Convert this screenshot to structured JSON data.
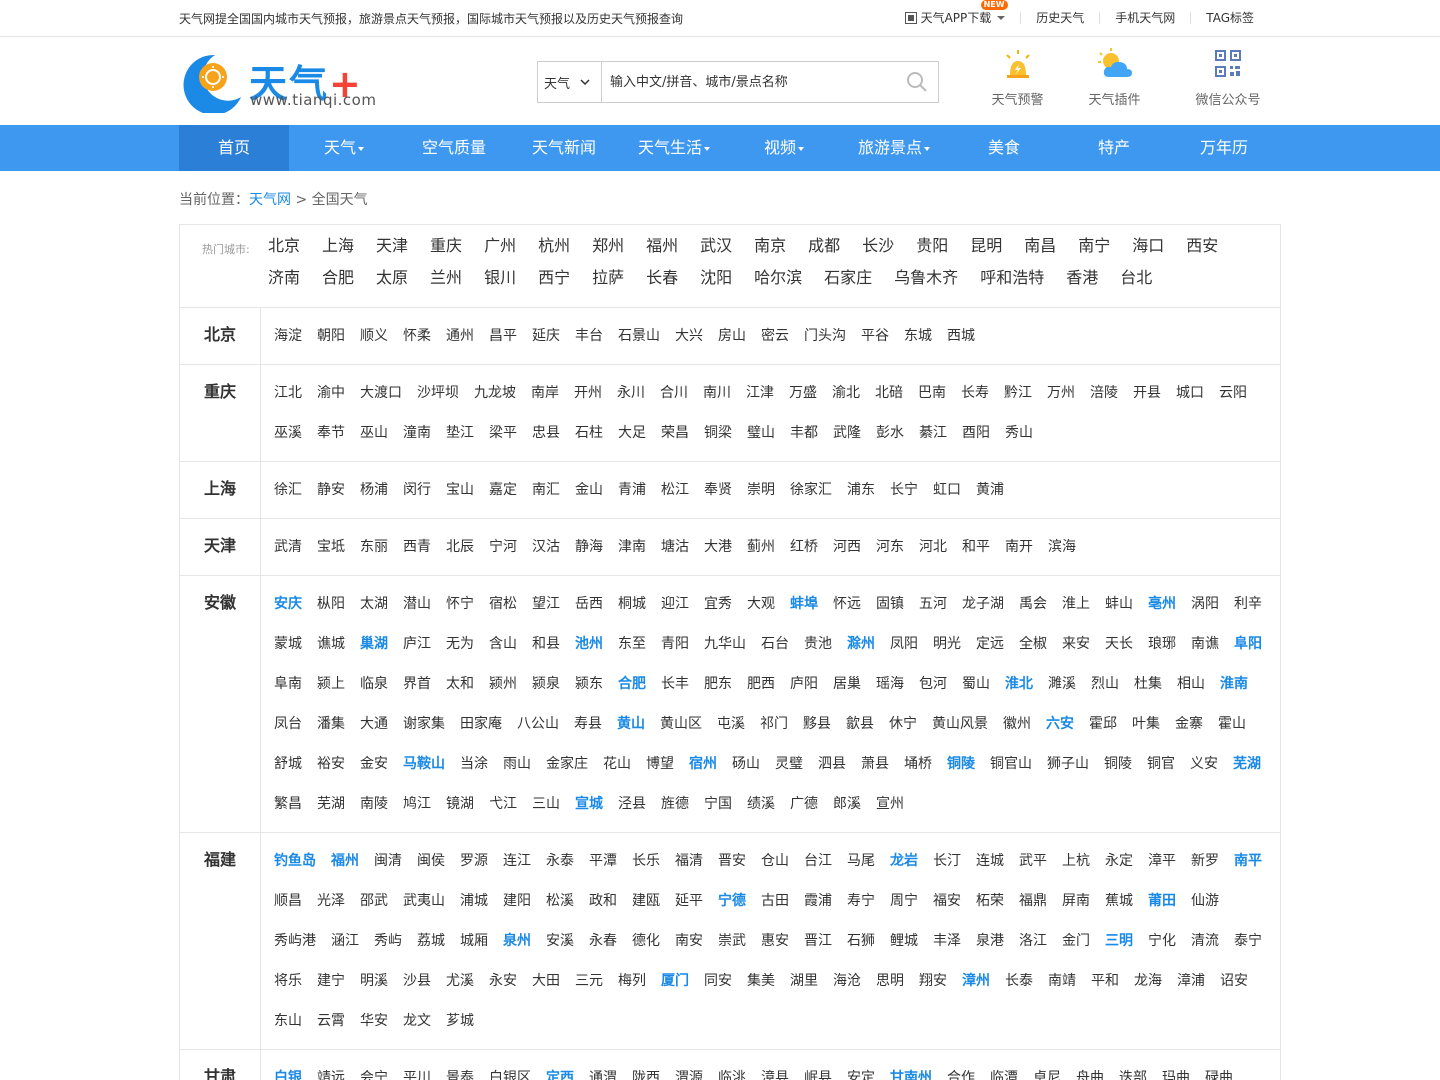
{
  "top": {
    "intro": "天气网提全国国内城市天气预报，旅游景点天气预报，国际城市天气预报以及历史天气预报查询",
    "app_download": "天气APP下载",
    "new_badge": "NEW",
    "history": "历史天气",
    "mobile": "手机天气网",
    "tags": "TAG标签"
  },
  "header": {
    "logo_text": "天气",
    "logo_plus": "+",
    "logo_url": "www.tianqi.com",
    "search_select": "天气",
    "search_placeholder": "输入中文/拼音、城市/景点名称",
    "tools": [
      {
        "label": "天气预警",
        "icon": "warning-sun-icon"
      },
      {
        "label": "天气插件",
        "icon": "cloud-sun-icon"
      },
      {
        "label": "微信公众号",
        "icon": "qrcode-icon"
      }
    ]
  },
  "nav": {
    "items": [
      {
        "label": "首页",
        "dropdown": false,
        "active": true
      },
      {
        "label": "天气",
        "dropdown": true
      },
      {
        "label": "空气质量",
        "dropdown": false
      },
      {
        "label": "天气新闻",
        "dropdown": false
      },
      {
        "label": "天气生活",
        "dropdown": true
      },
      {
        "label": "视频",
        "dropdown": true
      },
      {
        "label": "旅游景点",
        "dropdown": true
      },
      {
        "label": "美食",
        "dropdown": false
      },
      {
        "label": "特产",
        "dropdown": false
      },
      {
        "label": "万年历",
        "dropdown": false
      }
    ]
  },
  "breadcrumb": {
    "prefix": "当前位置：",
    "home": "天气网",
    "sep": " > ",
    "current": "全国天气"
  },
  "hot": {
    "label": "热门城市:",
    "cities": [
      "北京",
      "上海",
      "天津",
      "重庆",
      "广州",
      "杭州",
      "郑州",
      "福州",
      "武汉",
      "南京",
      "成都",
      "长沙",
      "贵阳",
      "昆明",
      "南昌",
      "南宁",
      "海口",
      "西安",
      "济南",
      "合肥",
      "太原",
      "兰州",
      "银川",
      "西宁",
      "拉萨",
      "长春",
      "沈阳",
      "哈尔滨",
      "石家庄",
      "乌鲁木齐",
      "呼和浩特",
      "香港",
      "台北"
    ]
  },
  "provinces": [
    {
      "name": "北京",
      "cities": [
        [
          "海淀",
          0
        ],
        [
          "朝阳",
          0
        ],
        [
          "顺义",
          0
        ],
        [
          "怀柔",
          0
        ],
        [
          "通州",
          0
        ],
        [
          "昌平",
          0
        ],
        [
          "延庆",
          0
        ],
        [
          "丰台",
          0
        ],
        [
          "石景山",
          0
        ],
        [
          "大兴",
          0
        ],
        [
          "房山",
          0
        ],
        [
          "密云",
          0
        ],
        [
          "门头沟",
          0
        ],
        [
          "平谷",
          0
        ],
        [
          "东城",
          0
        ],
        [
          "西城",
          0
        ]
      ]
    },
    {
      "name": "重庆",
      "cities": [
        [
          "江北",
          0
        ],
        [
          "渝中",
          0
        ],
        [
          "大渡口",
          0
        ],
        [
          "沙坪坝",
          0
        ],
        [
          "九龙坡",
          0
        ],
        [
          "南岸",
          0
        ],
        [
          "开州",
          0
        ],
        [
          "永川",
          0
        ],
        [
          "合川",
          0
        ],
        [
          "南川",
          0
        ],
        [
          "江津",
          0
        ],
        [
          "万盛",
          0
        ],
        [
          "渝北",
          0
        ],
        [
          "北碚",
          0
        ],
        [
          "巴南",
          0
        ],
        [
          "长寿",
          0
        ],
        [
          "黔江",
          0
        ],
        [
          "万州",
          0
        ],
        [
          "涪陵",
          0
        ],
        [
          "开县",
          0
        ],
        [
          "城口",
          0
        ],
        [
          "云阳",
          0
        ],
        [
          "巫溪",
          0
        ],
        [
          "奉节",
          0
        ],
        [
          "巫山",
          0
        ],
        [
          "潼南",
          0
        ],
        [
          "垫江",
          0
        ],
        [
          "梁平",
          0
        ],
        [
          "忠县",
          0
        ],
        [
          "石柱",
          0
        ],
        [
          "大足",
          0
        ],
        [
          "荣昌",
          0
        ],
        [
          "铜梁",
          0
        ],
        [
          "璧山",
          0
        ],
        [
          "丰都",
          0
        ],
        [
          "武隆",
          0
        ],
        [
          "彭水",
          0
        ],
        [
          "綦江",
          0
        ],
        [
          "酉阳",
          0
        ],
        [
          "秀山",
          0
        ]
      ]
    },
    {
      "name": "上海",
      "cities": [
        [
          "徐汇",
          0
        ],
        [
          "静安",
          0
        ],
        [
          "杨浦",
          0
        ],
        [
          "闵行",
          0
        ],
        [
          "宝山",
          0
        ],
        [
          "嘉定",
          0
        ],
        [
          "南汇",
          0
        ],
        [
          "金山",
          0
        ],
        [
          "青浦",
          0
        ],
        [
          "松江",
          0
        ],
        [
          "奉贤",
          0
        ],
        [
          "崇明",
          0
        ],
        [
          "徐家汇",
          0
        ],
        [
          "浦东",
          0
        ],
        [
          "长宁",
          0
        ],
        [
          "虹口",
          0
        ],
        [
          "黄浦",
          0
        ]
      ]
    },
    {
      "name": "天津",
      "cities": [
        [
          "武清",
          0
        ],
        [
          "宝坻",
          0
        ],
        [
          "东丽",
          0
        ],
        [
          "西青",
          0
        ],
        [
          "北辰",
          0
        ],
        [
          "宁河",
          0
        ],
        [
          "汉沽",
          0
        ],
        [
          "静海",
          0
        ],
        [
          "津南",
          0
        ],
        [
          "塘沽",
          0
        ],
        [
          "大港",
          0
        ],
        [
          "蓟州",
          0
        ],
        [
          "红桥",
          0
        ],
        [
          "河西",
          0
        ],
        [
          "河东",
          0
        ],
        [
          "河北",
          0
        ],
        [
          "和平",
          0
        ],
        [
          "南开",
          0
        ],
        [
          "滨海",
          0
        ]
      ]
    },
    {
      "name": "安徽",
      "cities": [
        [
          "安庆",
          1
        ],
        [
          "枞阳",
          0
        ],
        [
          "太湖",
          0
        ],
        [
          "潜山",
          0
        ],
        [
          "怀宁",
          0
        ],
        [
          "宿松",
          0
        ],
        [
          "望江",
          0
        ],
        [
          "岳西",
          0
        ],
        [
          "桐城",
          0
        ],
        [
          "迎江",
          0
        ],
        [
          "宜秀",
          0
        ],
        [
          "大观",
          0
        ],
        [
          "蚌埠",
          1
        ],
        [
          "怀远",
          0
        ],
        [
          "固镇",
          0
        ],
        [
          "五河",
          0
        ],
        [
          "龙子湖",
          0
        ],
        [
          "禹会",
          0
        ],
        [
          "淮上",
          0
        ],
        [
          "蚌山",
          0
        ],
        [
          "亳州",
          1
        ],
        [
          "涡阳",
          0
        ],
        [
          "利辛",
          0
        ],
        [
          "蒙城",
          0
        ],
        [
          "谯城",
          0
        ],
        [
          "巢湖",
          1
        ],
        [
          "庐江",
          0
        ],
        [
          "无为",
          0
        ],
        [
          "含山",
          0
        ],
        [
          "和县",
          0
        ],
        [
          "池州",
          1
        ],
        [
          "东至",
          0
        ],
        [
          "青阳",
          0
        ],
        [
          "九华山",
          0
        ],
        [
          "石台",
          0
        ],
        [
          "贵池",
          0
        ],
        [
          "滁州",
          1
        ],
        [
          "凤阳",
          0
        ],
        [
          "明光",
          0
        ],
        [
          "定远",
          0
        ],
        [
          "全椒",
          0
        ],
        [
          "来安",
          0
        ],
        [
          "天长",
          0
        ],
        [
          "琅琊",
          0
        ],
        [
          "南谯",
          0
        ],
        [
          "阜阳",
          1
        ],
        [
          "阜南",
          0
        ],
        [
          "颍上",
          0
        ],
        [
          "临泉",
          0
        ],
        [
          "界首",
          0
        ],
        [
          "太和",
          0
        ],
        [
          "颍州",
          0
        ],
        [
          "颍泉",
          0
        ],
        [
          "颍东",
          0
        ],
        [
          "合肥",
          1
        ],
        [
          "长丰",
          0
        ],
        [
          "肥东",
          0
        ],
        [
          "肥西",
          0
        ],
        [
          "庐阳",
          0
        ],
        [
          "居巢",
          0
        ],
        [
          "瑶海",
          0
        ],
        [
          "包河",
          0
        ],
        [
          "蜀山",
          0
        ],
        [
          "淮北",
          1
        ],
        [
          "濉溪",
          0
        ],
        [
          "烈山",
          0
        ],
        [
          "杜集",
          0
        ],
        [
          "相山",
          0
        ],
        [
          "淮南",
          1
        ],
        [
          "凤台",
          0
        ],
        [
          "潘集",
          0
        ],
        [
          "大通",
          0
        ],
        [
          "谢家集",
          0
        ],
        [
          "田家庵",
          0
        ],
        [
          "八公山",
          0
        ],
        [
          "寿县",
          0
        ],
        [
          "黄山",
          1
        ],
        [
          "黄山区",
          0
        ],
        [
          "屯溪",
          0
        ],
        [
          "祁门",
          0
        ],
        [
          "黟县",
          0
        ],
        [
          "歙县",
          0
        ],
        [
          "休宁",
          0
        ],
        [
          "黄山风景",
          0
        ],
        [
          "徽州",
          0
        ],
        [
          "六安",
          1
        ],
        [
          "霍邱",
          0
        ],
        [
          "叶集",
          0
        ],
        [
          "金寨",
          0
        ],
        [
          "霍山",
          0
        ],
        [
          "舒城",
          0
        ],
        [
          "裕安",
          0
        ],
        [
          "金安",
          0
        ],
        [
          "马鞍山",
          1
        ],
        [
          "当涂",
          0
        ],
        [
          "雨山",
          0
        ],
        [
          "金家庄",
          0
        ],
        [
          "花山",
          0
        ],
        [
          "博望",
          0
        ],
        [
          "宿州",
          1
        ],
        [
          "砀山",
          0
        ],
        [
          "灵璧",
          0
        ],
        [
          "泗县",
          0
        ],
        [
          "萧县",
          0
        ],
        [
          "埇桥",
          0
        ],
        [
          "铜陵",
          1
        ],
        [
          "铜官山",
          0
        ],
        [
          "狮子山",
          0
        ],
        [
          "铜陵",
          0
        ],
        [
          "铜官",
          0
        ],
        [
          "义安",
          0
        ],
        [
          "芜湖",
          1
        ],
        [
          "繁昌",
          0
        ],
        [
          "芜湖",
          0
        ],
        [
          "南陵",
          0
        ],
        [
          "鸠江",
          0
        ],
        [
          "镜湖",
          0
        ],
        [
          "弋江",
          0
        ],
        [
          "三山",
          0
        ],
        [
          "宣城",
          1
        ],
        [
          "泾县",
          0
        ],
        [
          "旌德",
          0
        ],
        [
          "宁国",
          0
        ],
        [
          "绩溪",
          0
        ],
        [
          "广德",
          0
        ],
        [
          "郎溪",
          0
        ],
        [
          "宣州",
          0
        ]
      ]
    },
    {
      "name": "福建",
      "cities": [
        [
          "钓鱼岛",
          1
        ],
        [
          "福州",
          1
        ],
        [
          "闽清",
          0
        ],
        [
          "闽侯",
          0
        ],
        [
          "罗源",
          0
        ],
        [
          "连江",
          0
        ],
        [
          "永泰",
          0
        ],
        [
          "平潭",
          0
        ],
        [
          "长乐",
          0
        ],
        [
          "福清",
          0
        ],
        [
          "晋安",
          0
        ],
        [
          "仓山",
          0
        ],
        [
          "台江",
          0
        ],
        [
          "马尾",
          0
        ],
        [
          "龙岩",
          1
        ],
        [
          "长汀",
          0
        ],
        [
          "连城",
          0
        ],
        [
          "武平",
          0
        ],
        [
          "上杭",
          0
        ],
        [
          "永定",
          0
        ],
        [
          "漳平",
          0
        ],
        [
          "新罗",
          0
        ],
        [
          "南平",
          1
        ],
        [
          "顺昌",
          0
        ],
        [
          "光泽",
          0
        ],
        [
          "邵武",
          0
        ],
        [
          "武夷山",
          0
        ],
        [
          "浦城",
          0
        ],
        [
          "建阳",
          0
        ],
        [
          "松溪",
          0
        ],
        [
          "政和",
          0
        ],
        [
          "建瓯",
          0
        ],
        [
          "延平",
          0
        ],
        [
          "宁德",
          1
        ],
        [
          "古田",
          0
        ],
        [
          "霞浦",
          0
        ],
        [
          "寿宁",
          0
        ],
        [
          "周宁",
          0
        ],
        [
          "福安",
          0
        ],
        [
          "柘荣",
          0
        ],
        [
          "福鼎",
          0
        ],
        [
          "屏南",
          0
        ],
        [
          "蕉城",
          0
        ],
        [
          "莆田",
          1
        ],
        [
          "仙游",
          0
        ],
        [
          "秀屿港",
          0
        ],
        [
          "涵江",
          0
        ],
        [
          "秀屿",
          0
        ],
        [
          "荔城",
          0
        ],
        [
          "城厢",
          0
        ],
        [
          "泉州",
          1
        ],
        [
          "安溪",
          0
        ],
        [
          "永春",
          0
        ],
        [
          "德化",
          0
        ],
        [
          "南安",
          0
        ],
        [
          "崇武",
          0
        ],
        [
          "惠安",
          0
        ],
        [
          "晋江",
          0
        ],
        [
          "石狮",
          0
        ],
        [
          "鲤城",
          0
        ],
        [
          "丰泽",
          0
        ],
        [
          "泉港",
          0
        ],
        [
          "洛江",
          0
        ],
        [
          "金门",
          0
        ],
        [
          "三明",
          1
        ],
        [
          "宁化",
          0
        ],
        [
          "清流",
          0
        ],
        [
          "泰宁",
          0
        ],
        [
          "将乐",
          0
        ],
        [
          "建宁",
          0
        ],
        [
          "明溪",
          0
        ],
        [
          "沙县",
          0
        ],
        [
          "尤溪",
          0
        ],
        [
          "永安",
          0
        ],
        [
          "大田",
          0
        ],
        [
          "三元",
          0
        ],
        [
          "梅列",
          0
        ],
        [
          "厦门",
          1
        ],
        [
          "同安",
          0
        ],
        [
          "集美",
          0
        ],
        [
          "湖里",
          0
        ],
        [
          "海沧",
          0
        ],
        [
          "思明",
          0
        ],
        [
          "翔安",
          0
        ],
        [
          "漳州",
          1
        ],
        [
          "长泰",
          0
        ],
        [
          "南靖",
          0
        ],
        [
          "平和",
          0
        ],
        [
          "龙海",
          0
        ],
        [
          "漳浦",
          0
        ],
        [
          "诏安",
          0
        ],
        [
          "东山",
          0
        ],
        [
          "云霄",
          0
        ],
        [
          "华安",
          0
        ],
        [
          "龙文",
          0
        ],
        [
          "芗城",
          0
        ]
      ]
    },
    {
      "name": "甘肃",
      "cities": [
        [
          "白银",
          1
        ],
        [
          "靖远",
          0
        ],
        [
          "会宁",
          0
        ],
        [
          "平川",
          0
        ],
        [
          "景泰",
          0
        ],
        [
          "白银区",
          0
        ],
        [
          "定西",
          1
        ],
        [
          "通渭",
          0
        ],
        [
          "陇西",
          0
        ],
        [
          "渭源",
          0
        ],
        [
          "临洮",
          0
        ],
        [
          "漳县",
          0
        ],
        [
          "岷县",
          0
        ],
        [
          "安定",
          0
        ],
        [
          "甘南州",
          1
        ],
        [
          "合作",
          0
        ],
        [
          "临潭",
          0
        ],
        [
          "卓尼",
          0
        ],
        [
          "舟曲",
          0
        ],
        [
          "迭部",
          0
        ],
        [
          "玛曲",
          0
        ],
        [
          "碌曲",
          0
        ]
      ]
    }
  ]
}
